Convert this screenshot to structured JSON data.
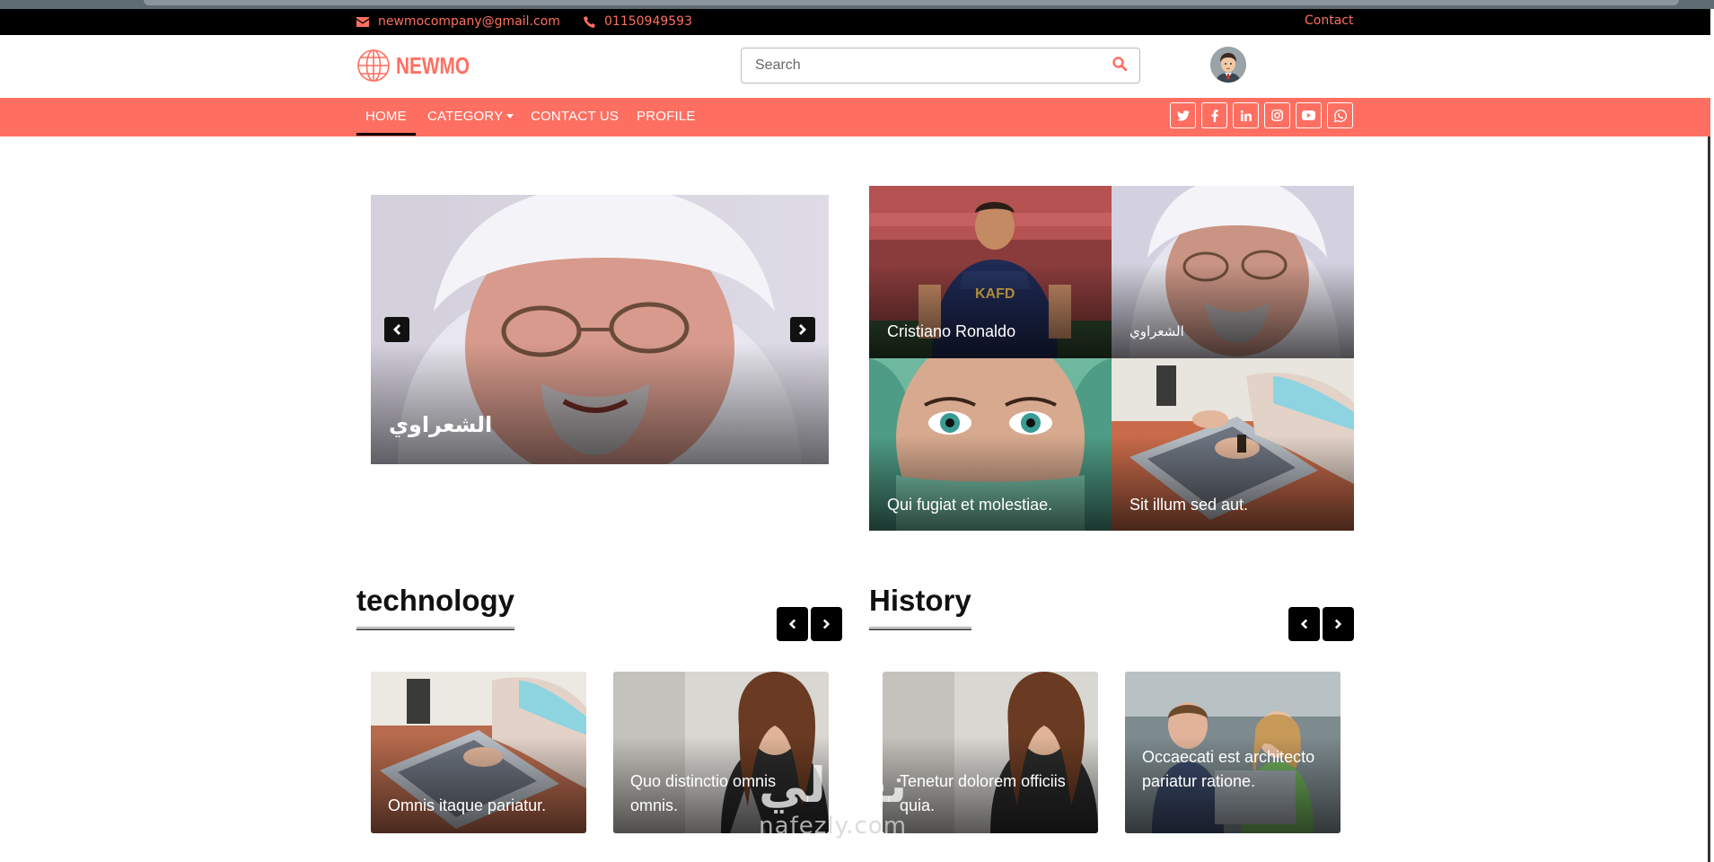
{
  "topbar": {
    "email": "newmocompany@gmail.com",
    "phone": "01150949593",
    "contact_link": "Contact"
  },
  "header": {
    "logo_text": "NEWMO",
    "search_placeholder": "Search",
    "search_icon": "search-icon",
    "avatar_icon": "user-avatar"
  },
  "nav": {
    "items": [
      "HOME",
      "CATEGORY",
      "CONTACT US",
      "PROFILE"
    ],
    "active": "HOME",
    "social_icons": [
      "twitter-icon",
      "facebook-icon",
      "linkedin-icon",
      "instagram-icon",
      "youtube-icon",
      "whatsapp-icon"
    ]
  },
  "hero": {
    "main_caption": "الشعراوي",
    "tiles": [
      {
        "caption": "Cristiano Ronaldo"
      },
      {
        "caption": "الشعراوي"
      },
      {
        "caption": "Qui fugiat et molestiae."
      },
      {
        "caption": "Sit illum sed aut."
      }
    ]
  },
  "sections": [
    {
      "title": "technology",
      "cards": [
        {
          "caption": "Omnis itaque pariatur."
        },
        {
          "caption": "Quo distinctio omnis omnis."
        }
      ]
    },
    {
      "title": "History",
      "cards": [
        {
          "caption": "Tenetur dolorem officiis quia."
        },
        {
          "caption": "Occaecati est architecto pariatur ratione."
        }
      ]
    }
  ],
  "watermark": {
    "arabic": "نفذلي",
    "latin": "nafezly.com"
  },
  "colors": {
    "accent": "#ff6f61",
    "topbar_bg": "#000000",
    "text_dark": "#111111"
  }
}
